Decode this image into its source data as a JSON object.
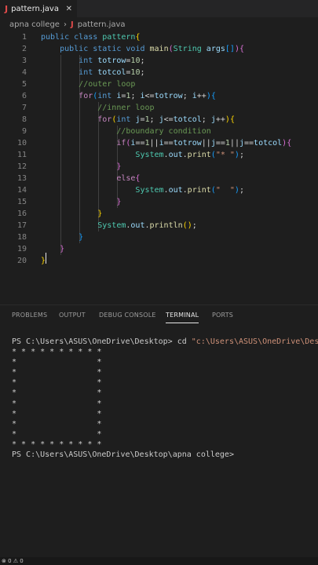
{
  "tab": {
    "file": "pattern.java",
    "icon": "J",
    "close": "✕"
  },
  "breadcrumb": {
    "folder": "apna college",
    "sep": "›",
    "file": "pattern.java"
  },
  "code": [
    {
      "n": "1",
      "segs": [
        [
          "kw",
          "public "
        ],
        [
          "kw",
          "class "
        ],
        [
          "ty",
          "pattern"
        ],
        [
          "b1",
          "{"
        ]
      ]
    },
    {
      "n": "2",
      "segs": [
        [
          "op",
          "    "
        ],
        [
          "kw",
          "public "
        ],
        [
          "kw",
          "static "
        ],
        [
          "kw",
          "void "
        ],
        [
          "fn",
          "main"
        ],
        [
          "b2",
          "("
        ],
        [
          "ty",
          "String "
        ],
        [
          "va",
          "args"
        ],
        [
          "b3",
          "[]"
        ],
        [
          "b2",
          ")"
        ],
        [
          "b2",
          "{"
        ]
      ]
    },
    {
      "n": "3",
      "segs": [
        [
          "op",
          "        "
        ],
        [
          "kw",
          "int "
        ],
        [
          "va",
          "totrow"
        ],
        [
          "op",
          "="
        ],
        [
          "nu",
          "10"
        ],
        [
          "op",
          ";"
        ]
      ]
    },
    {
      "n": "4",
      "segs": [
        [
          "op",
          "        "
        ],
        [
          "kw",
          "int "
        ],
        [
          "va",
          "totcol"
        ],
        [
          "op",
          "="
        ],
        [
          "nu",
          "10"
        ],
        [
          "op",
          ";"
        ]
      ]
    },
    {
      "n": "5",
      "segs": [
        [
          "op",
          "        "
        ],
        [
          "cm",
          "//outer loop"
        ]
      ]
    },
    {
      "n": "6",
      "segs": [
        [
          "op",
          "        "
        ],
        [
          "kw2",
          "for"
        ],
        [
          "b3",
          "("
        ],
        [
          "kw",
          "int "
        ],
        [
          "va",
          "i"
        ],
        [
          "op",
          "="
        ],
        [
          "nu",
          "1"
        ],
        [
          "op",
          "; "
        ],
        [
          "va",
          "i"
        ],
        [
          "op",
          "<="
        ],
        [
          "va",
          "totrow"
        ],
        [
          "op",
          "; "
        ],
        [
          "va",
          "i"
        ],
        [
          "op",
          "++"
        ],
        [
          "b3",
          ")"
        ],
        [
          "b3",
          "{"
        ]
      ]
    },
    {
      "n": "7",
      "segs": [
        [
          "op",
          "            "
        ],
        [
          "cm",
          "//inner loop"
        ]
      ]
    },
    {
      "n": "8",
      "segs": [
        [
          "op",
          "            "
        ],
        [
          "kw2",
          "for"
        ],
        [
          "b1",
          "("
        ],
        [
          "kw",
          "int "
        ],
        [
          "va",
          "j"
        ],
        [
          "op",
          "="
        ],
        [
          "nu",
          "1"
        ],
        [
          "op",
          "; "
        ],
        [
          "va",
          "j"
        ],
        [
          "op",
          "<="
        ],
        [
          "va",
          "totcol"
        ],
        [
          "op",
          "; "
        ],
        [
          "va",
          "j"
        ],
        [
          "op",
          "++"
        ],
        [
          "b1",
          ")"
        ],
        [
          "b1",
          "{"
        ]
      ]
    },
    {
      "n": "9",
      "segs": [
        [
          "op",
          "                "
        ],
        [
          "cm",
          "//boundary condition"
        ]
      ]
    },
    {
      "n": "10",
      "segs": [
        [
          "op",
          "                "
        ],
        [
          "kw2",
          "if"
        ],
        [
          "b2",
          "("
        ],
        [
          "va",
          "i"
        ],
        [
          "op",
          "=="
        ],
        [
          "nu",
          "1"
        ],
        [
          "op",
          "||"
        ],
        [
          "va",
          "i"
        ],
        [
          "op",
          "=="
        ],
        [
          "va",
          "totrow"
        ],
        [
          "op",
          "||"
        ],
        [
          "va",
          "j"
        ],
        [
          "op",
          "=="
        ],
        [
          "nu",
          "1"
        ],
        [
          "op",
          "||"
        ],
        [
          "va",
          "j"
        ],
        [
          "op",
          "=="
        ],
        [
          "va",
          "totcol"
        ],
        [
          "b2",
          ")"
        ],
        [
          "b2",
          "{"
        ]
      ]
    },
    {
      "n": "11",
      "segs": [
        [
          "op",
          "                    "
        ],
        [
          "ty",
          "System"
        ],
        [
          "op",
          "."
        ],
        [
          "va",
          "out"
        ],
        [
          "op",
          "."
        ],
        [
          "fn",
          "print"
        ],
        [
          "b3",
          "("
        ],
        [
          "st",
          "\"* \""
        ],
        [
          "b3",
          ")"
        ],
        [
          "op",
          ";"
        ]
      ]
    },
    {
      "n": "12",
      "segs": [
        [
          "op",
          "                "
        ],
        [
          "b2",
          "}"
        ]
      ]
    },
    {
      "n": "13",
      "segs": [
        [
          "op",
          "                "
        ],
        [
          "kw2",
          "else"
        ],
        [
          "b2",
          "{"
        ]
      ]
    },
    {
      "n": "14",
      "segs": [
        [
          "op",
          "                    "
        ],
        [
          "ty",
          "System"
        ],
        [
          "op",
          "."
        ],
        [
          "va",
          "out"
        ],
        [
          "op",
          "."
        ],
        [
          "fn",
          "print"
        ],
        [
          "b3",
          "("
        ],
        [
          "st",
          "\"  \""
        ],
        [
          "b3",
          ")"
        ],
        [
          "op",
          ";"
        ]
      ]
    },
    {
      "n": "15",
      "segs": [
        [
          "op",
          "                "
        ],
        [
          "b2",
          "}"
        ]
      ]
    },
    {
      "n": "16",
      "segs": [
        [
          "op",
          "            "
        ],
        [
          "b1",
          "}"
        ]
      ]
    },
    {
      "n": "17",
      "segs": [
        [
          "op",
          "            "
        ],
        [
          "ty",
          "System"
        ],
        [
          "op",
          "."
        ],
        [
          "va",
          "out"
        ],
        [
          "op",
          "."
        ],
        [
          "fn",
          "println"
        ],
        [
          "b1",
          "("
        ],
        [
          "b1",
          ")"
        ],
        [
          "op",
          ";"
        ]
      ]
    },
    {
      "n": "18",
      "segs": [
        [
          "op",
          "        "
        ],
        [
          "b3",
          "}"
        ]
      ]
    },
    {
      "n": "19",
      "segs": [
        [
          "op",
          "    "
        ],
        [
          "b2",
          "}"
        ]
      ]
    },
    {
      "n": "20",
      "segs": [
        [
          "b1",
          "}"
        ]
      ]
    }
  ],
  "panel_tabs": [
    "PROBLEMS",
    "OUTPUT",
    "DEBUG CONSOLE",
    "TERMINAL",
    "PORTS"
  ],
  "active_panel_tab": "TERMINAL",
  "terminal": {
    "prompt_line": "PS C:\\Users\\ASUS\\OneDrive\\Desktop> cd ",
    "command_arg": "\"c:\\Users\\ASUS\\OneDrive\\Des",
    "output": [
      "* * * * * * * * * *",
      "*                 *",
      "*                 *",
      "*                 *",
      "*                 *",
      "*                 *",
      "*                 *",
      "*                 *",
      "*                 *",
      "* * * * * * * * * *"
    ],
    "final_prompt": "PS C:\\Users\\ASUS\\OneDrive\\Desktop\\apna college>"
  },
  "status": {
    "text": "⊗ 0 ⚠ 0"
  }
}
